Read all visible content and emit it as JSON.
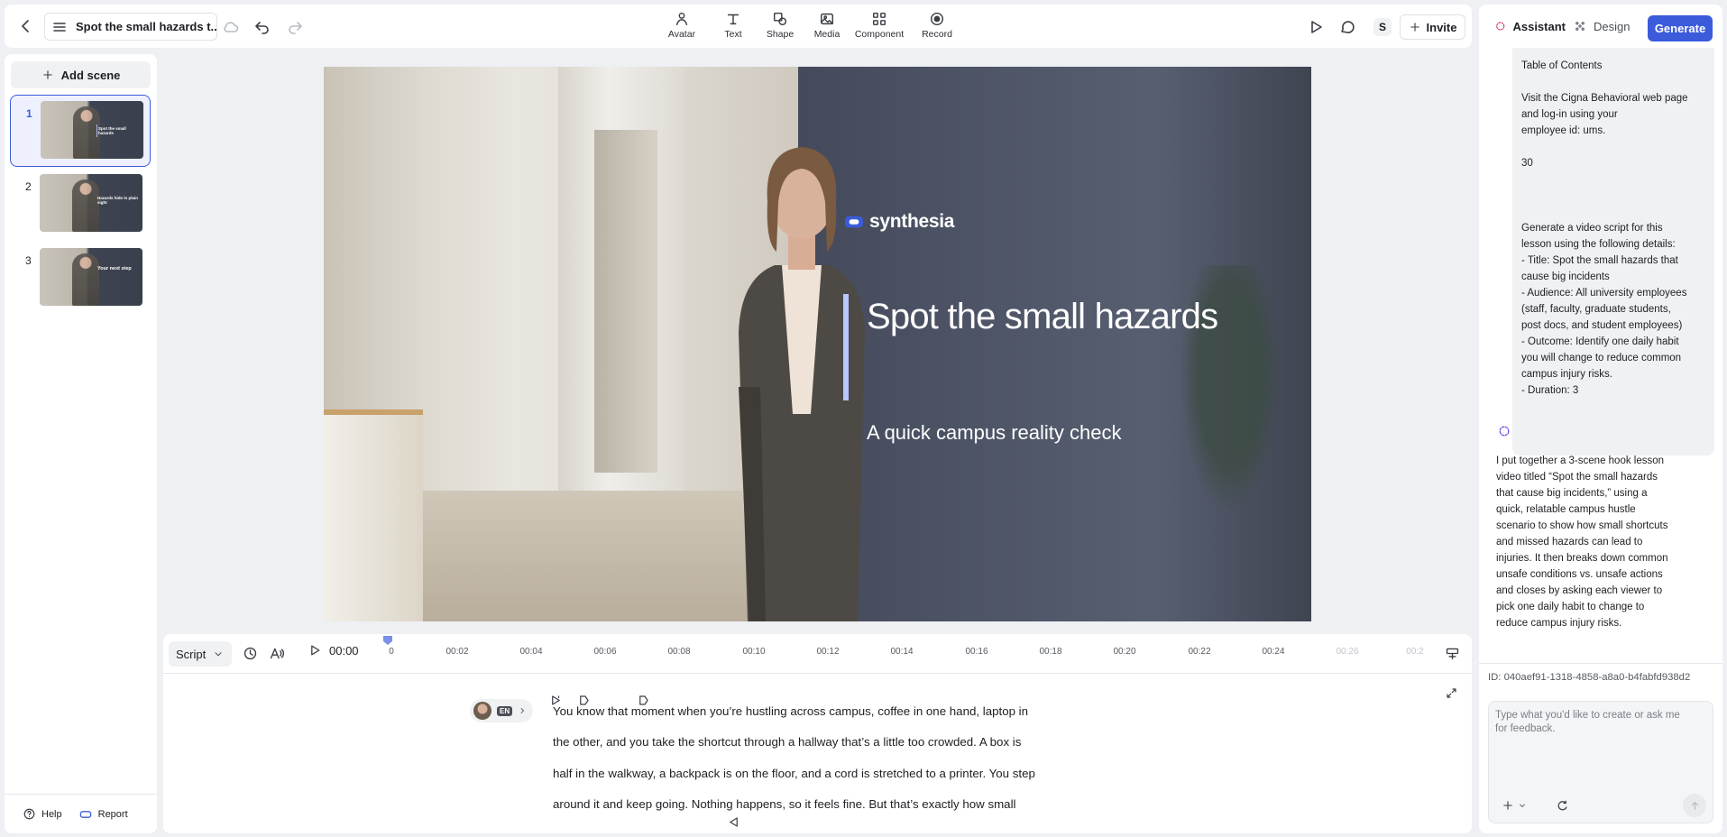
{
  "topbar": {
    "project_title": "Spot the small hazards t...",
    "tools": [
      {
        "label": "Avatar",
        "icon": "avatar-icon"
      },
      {
        "label": "Text",
        "icon": "text-icon"
      },
      {
        "label": "Shape",
        "icon": "shape-icon"
      },
      {
        "label": "Media",
        "icon": "media-icon"
      },
      {
        "label": "Component",
        "icon": "component-icon"
      },
      {
        "label": "Record",
        "icon": "record-icon"
      }
    ],
    "user_initial": "S",
    "invite_label": "Invite"
  },
  "right_tabs": {
    "assistant_label": "Assistant",
    "design_label": "Design",
    "generate_label": "Generate"
  },
  "sidebar": {
    "add_scene_label": "Add scene",
    "scenes": [
      {
        "number": "1",
        "thumb_title": "Spot the small hazards"
      },
      {
        "number": "2",
        "thumb_title": "Hazards hide in plain sight"
      },
      {
        "number": "3",
        "thumb_title": "Your next step"
      }
    ],
    "help_label": "Help",
    "report_label": "Report"
  },
  "slide": {
    "logo_text": "synthesia",
    "title": "Spot the small hazards",
    "subtitle": "A quick campus reality check"
  },
  "timeline": {
    "mode_label": "Script",
    "time": "00:00",
    "ticks": [
      "0",
      "00:02",
      "00:04",
      "00:06",
      "00:08",
      "00:10",
      "00:12",
      "00:14",
      "00:16",
      "00:18",
      "00:20",
      "00:22",
      "00:24",
      "00:26",
      "00:2"
    ]
  },
  "script": {
    "language": "EN",
    "lines": [
      "You know that moment when you’re hustling across campus, coffee in one hand, laptop in",
      "the other, and you take the shortcut through a hallway that’s a little too crowded. A box is",
      "half in the walkway, a backpack is on the floor, and a cord is stretched to a printer. You step",
      "around it and keep going. Nothing happens, so it feels fine. But that’s exactly how small"
    ]
  },
  "chat": {
    "user_message_lines": [
      "Table of Contents",
      "",
      "Visit the Cigna Behavioral web page",
      "and log-in using your",
      "employee id: ums.",
      "",
      "30",
      "",
      "",
      "",
      "Generate a video script for this",
      "lesson using the following details:",
      "- Title: Spot the small hazards that",
      "cause big incidents",
      "- Audience: All university employees",
      "(staff, faculty, graduate students,",
      "post docs, and student employees)",
      "- Outcome: Identify one daily habit",
      "you will change to reduce common",
      "campus injury risks.",
      "- Duration: 3"
    ],
    "assistant_message_lines": [
      "I put together a 3-scene hook lesson",
      "video titled “Spot the small hazards",
      "that cause big incidents,” using a",
      "quick, relatable campus hustle",
      "scenario to show how small shortcuts",
      "and missed hazards can lead to",
      "injuries. It then breaks down common",
      "unsafe conditions vs. unsafe actions",
      "and closes by asking each viewer to",
      "pick one daily habit to change to",
      "reduce campus injury risks."
    ],
    "chat_id": "ID: 040aef91-1318-4858-a8a0-b4fabfd938d2",
    "input_placeholder": "Type what you'd like to create or ask me for feedback."
  },
  "colors": {
    "accent": "#3b5bdb",
    "slide_accent_bar": "#b9c6ff"
  }
}
